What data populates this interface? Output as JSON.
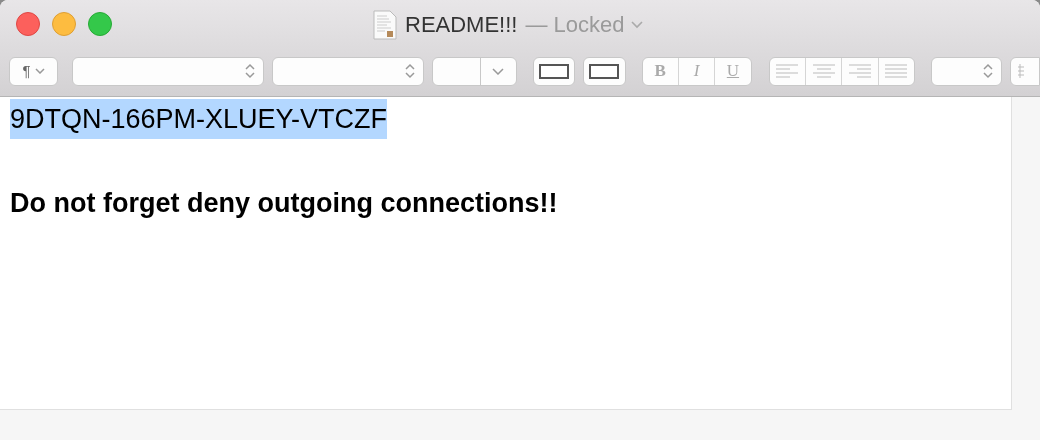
{
  "window": {
    "title": "README!!!",
    "status": "— Locked"
  },
  "toolbar": {
    "paragraph_style": "¶",
    "text_styles": [
      "B",
      "I",
      "U"
    ]
  },
  "document": {
    "paragraphs": [
      {
        "text": "9DTQN-166PM-XLUEY-VTCZF",
        "bold": false,
        "selected": true
      },
      {
        "text": "Do not forget deny outgoing connections!!",
        "bold": true,
        "selected": false
      }
    ]
  }
}
